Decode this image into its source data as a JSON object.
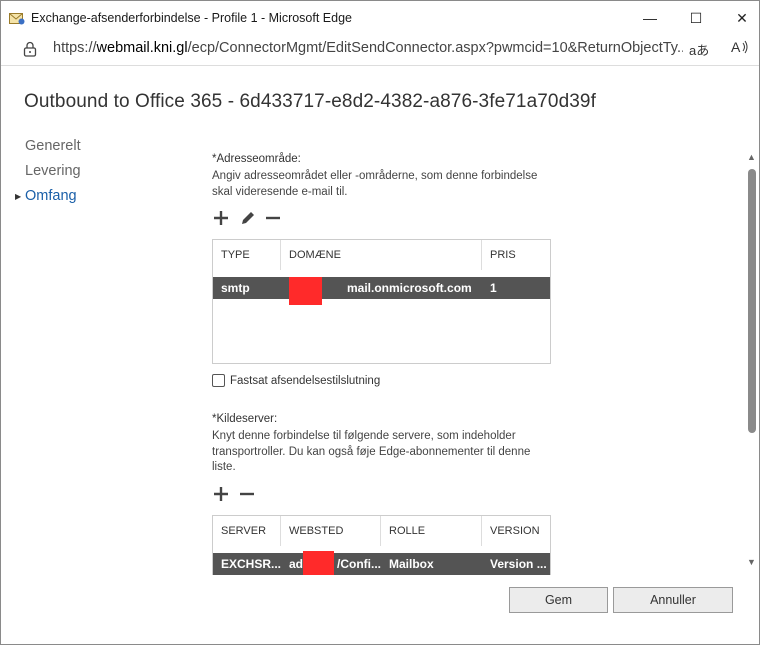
{
  "window": {
    "title": "Exchange-afsenderforbindelse - Profile 1 - Microsoft Edge",
    "minimize": "—",
    "maximize": "☐",
    "close": "✕"
  },
  "address_bar": {
    "url_prefix": "https://",
    "url_host": "webmail.kni.gl",
    "url_path": "/ecp/ConnectorMgmt/EditSendConnector.aspx?pwmcid=10&ReturnObjectTy...",
    "read_aloud_icon": "aあ",
    "immersive_icon": "A̩)"
  },
  "page": {
    "title": "Outbound to Office 365 - 6d433717-e8d2-4382-a876-3fe71a70d39f"
  },
  "nav": {
    "items": [
      {
        "label": "Generelt",
        "active": false
      },
      {
        "label": "Levering",
        "active": false
      },
      {
        "label": "Omfang",
        "active": true
      }
    ]
  },
  "address_space": {
    "label": "*Adresseområde:",
    "description": "Angiv adresseområdet eller -områderne, som denne forbindelse skal videresende e-mail til.",
    "columns": [
      "TYPE",
      "DOMÆNE",
      "PRIS"
    ],
    "rows": [
      {
        "type": "smtp",
        "domain": "mail.onmicrosoft.com",
        "cost": "1"
      }
    ]
  },
  "scoped": {
    "label": "Fastsat afsendelsestilslutning",
    "checked": false
  },
  "source_server": {
    "label": "*Kildeserver:",
    "description": "Knyt denne forbindelse til følgende servere, som indeholder transportroller. Du kan også føje Edge-abonnementer til denne liste.",
    "columns": [
      "SERVER",
      "WEBSTED",
      "ROLLE",
      "VERSION"
    ],
    "rows": [
      {
        "server": "EXCHSR...",
        "site_prefix": "ad",
        "site_suffix": "/Confi...",
        "role": "Mailbox",
        "version": "Version ..."
      }
    ]
  },
  "buttons": {
    "save": "Gem",
    "cancel": "Annuller"
  },
  "colors": {
    "accent": "#1a5fa8",
    "selected_row": "#545454",
    "redaction": "#ff2a2a"
  }
}
